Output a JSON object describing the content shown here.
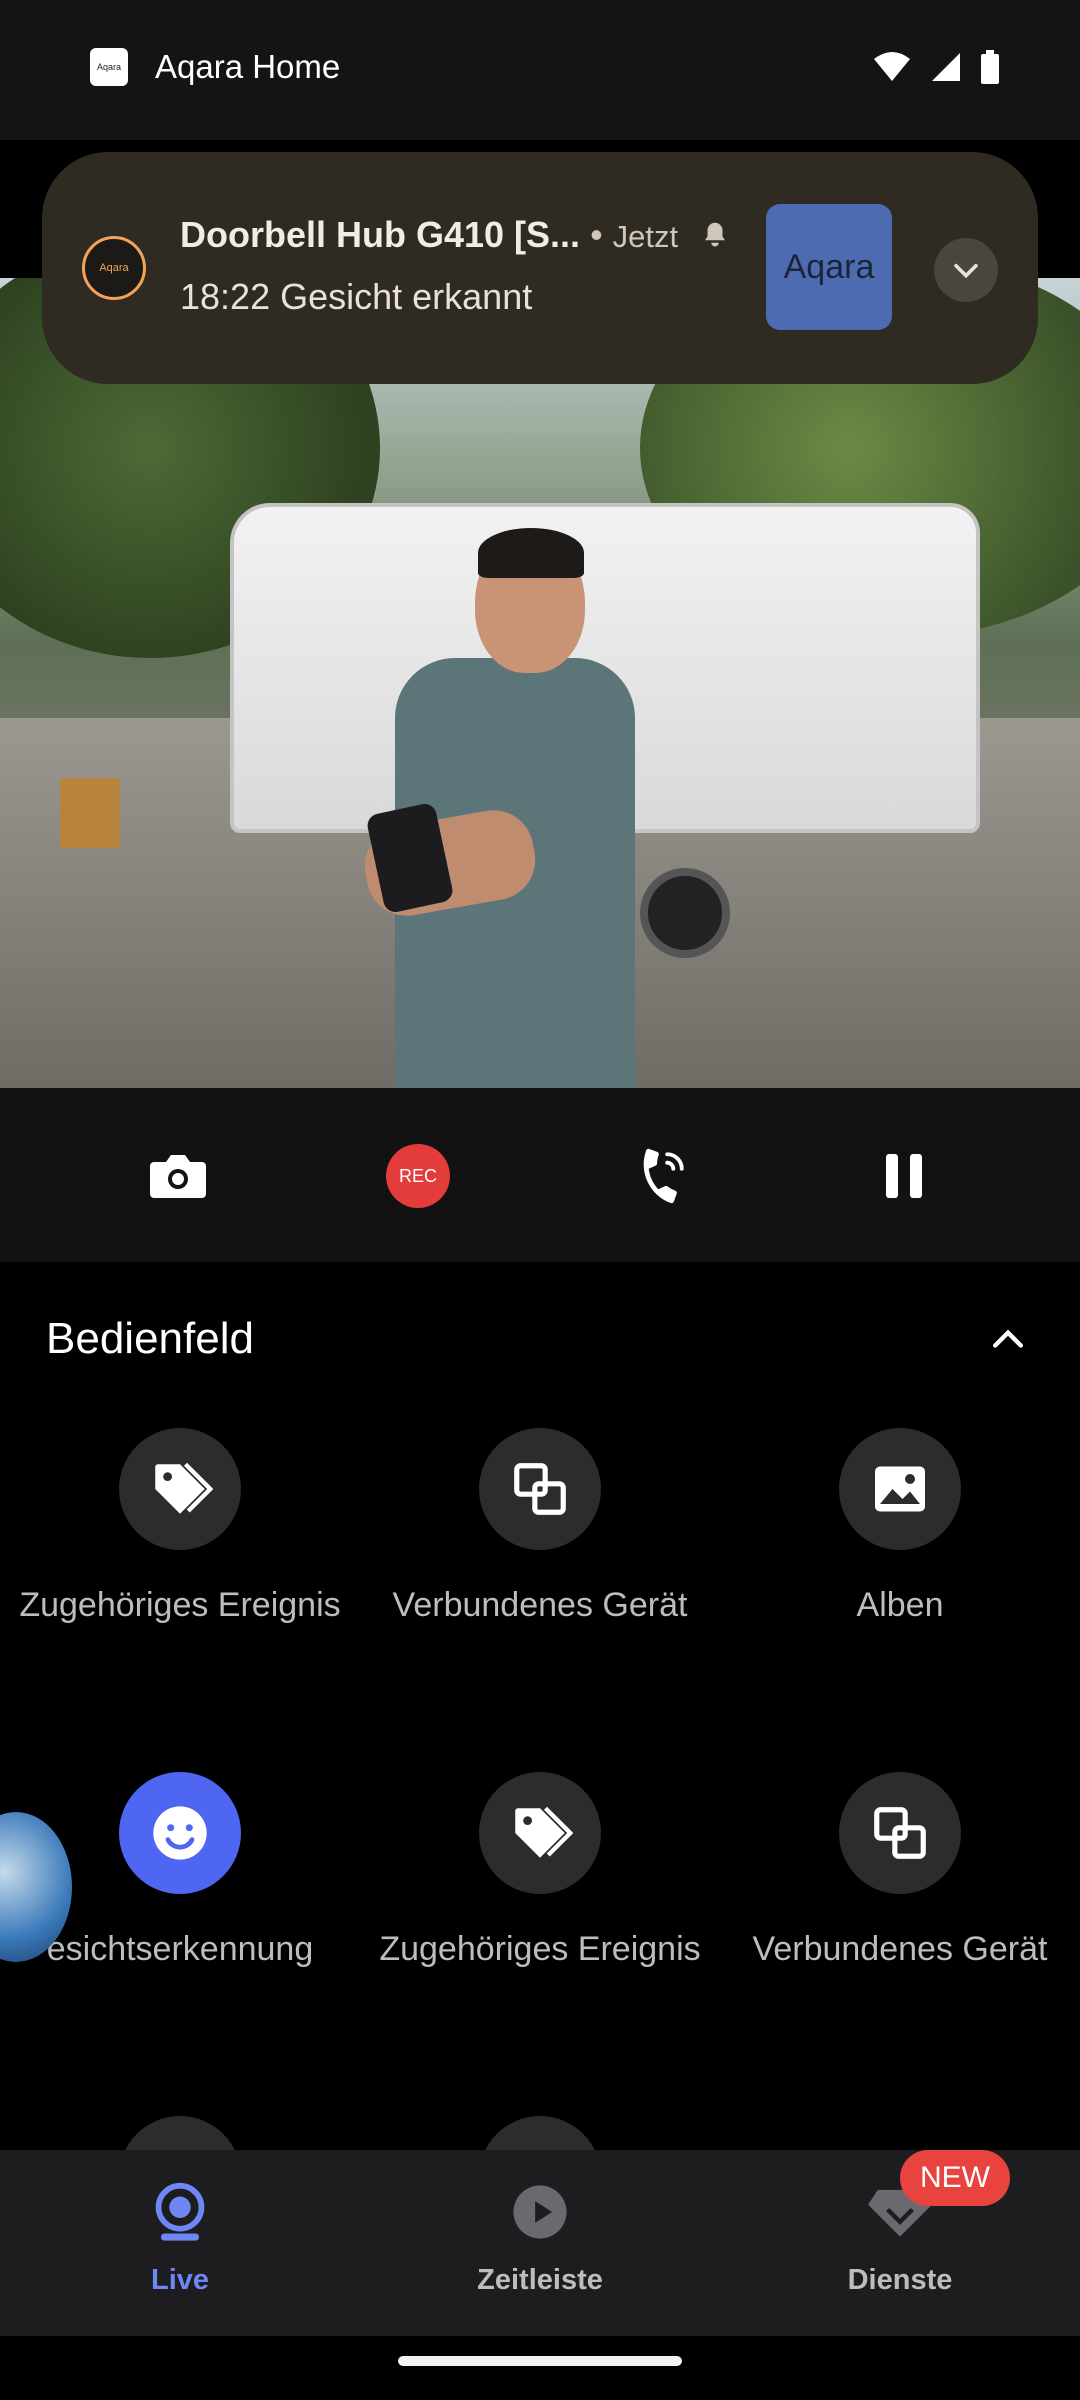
{
  "statusbar": {
    "app_name": "Aqara Home",
    "app_icon_text": "Aqara"
  },
  "notification": {
    "logo_text": "Aqara",
    "title": "Doorbell Hub G410 [S...",
    "dot": " • ",
    "time": "Jetzt",
    "body": "18:22 Gesicht erkannt",
    "thumbnail_text": "Aqara"
  },
  "controls": {
    "rec_label": "REC"
  },
  "panel": {
    "title": "Bedienfeld",
    "tiles": [
      {
        "label": "Zugehöriges Ereignis",
        "icon": "tag-icon"
      },
      {
        "label": "Verbundenes Gerät",
        "icon": "linked-devices-icon"
      },
      {
        "label": "Alben",
        "icon": "image-icon"
      },
      {
        "label": "esichtserkennung",
        "icon": "face-icon"
      },
      {
        "label": "Zugehöriges Ereignis",
        "icon": "tag-icon"
      },
      {
        "label": "Verbundenes Gerät",
        "icon": "linked-devices-icon"
      }
    ]
  },
  "bottomnav": {
    "items": [
      {
        "label": "Live",
        "icon": "live-camera-icon",
        "active": true
      },
      {
        "label": "Zeitleiste",
        "icon": "play-icon",
        "active": false
      },
      {
        "label": "Dienste",
        "icon": "diamond-icon",
        "active": false
      }
    ],
    "new_badge": "NEW"
  },
  "colors": {
    "accent": "#4f66f2",
    "nav_active": "#6f86f5",
    "rec": "#e43b3b",
    "notification_bg": "#2f2a22"
  }
}
